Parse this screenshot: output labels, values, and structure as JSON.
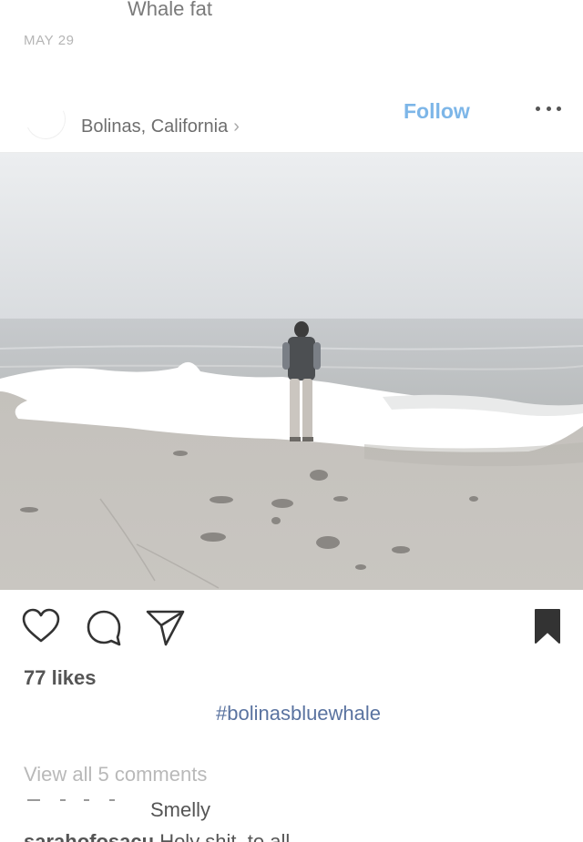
{
  "previous_post": {
    "caption_tail": "Whale fat",
    "date": "MAY 29"
  },
  "post": {
    "location": "Bolinas, California",
    "location_chevron": "›",
    "follow_label": "Follow",
    "more_icon": "more-horizontal-icon",
    "photo_subject": "beach-photo",
    "likes": "77 likes",
    "hashtag": "#bolinasbluewhale",
    "view_comments": "View all 5 comments",
    "comments": [
      {
        "text": "Smelly"
      },
      {
        "user": "sarahofosacu",
        "text": "Holy shit, to all"
      }
    ],
    "actions": {
      "like_icon": "heart-icon",
      "comment_icon": "comment-bubble-icon",
      "share_icon": "paper-plane-icon",
      "save_icon": "bookmark-icon"
    }
  },
  "colors": {
    "follow": "#7db6e8",
    "hashtag": "#5a73a0",
    "muted": "#b9b9b9"
  }
}
